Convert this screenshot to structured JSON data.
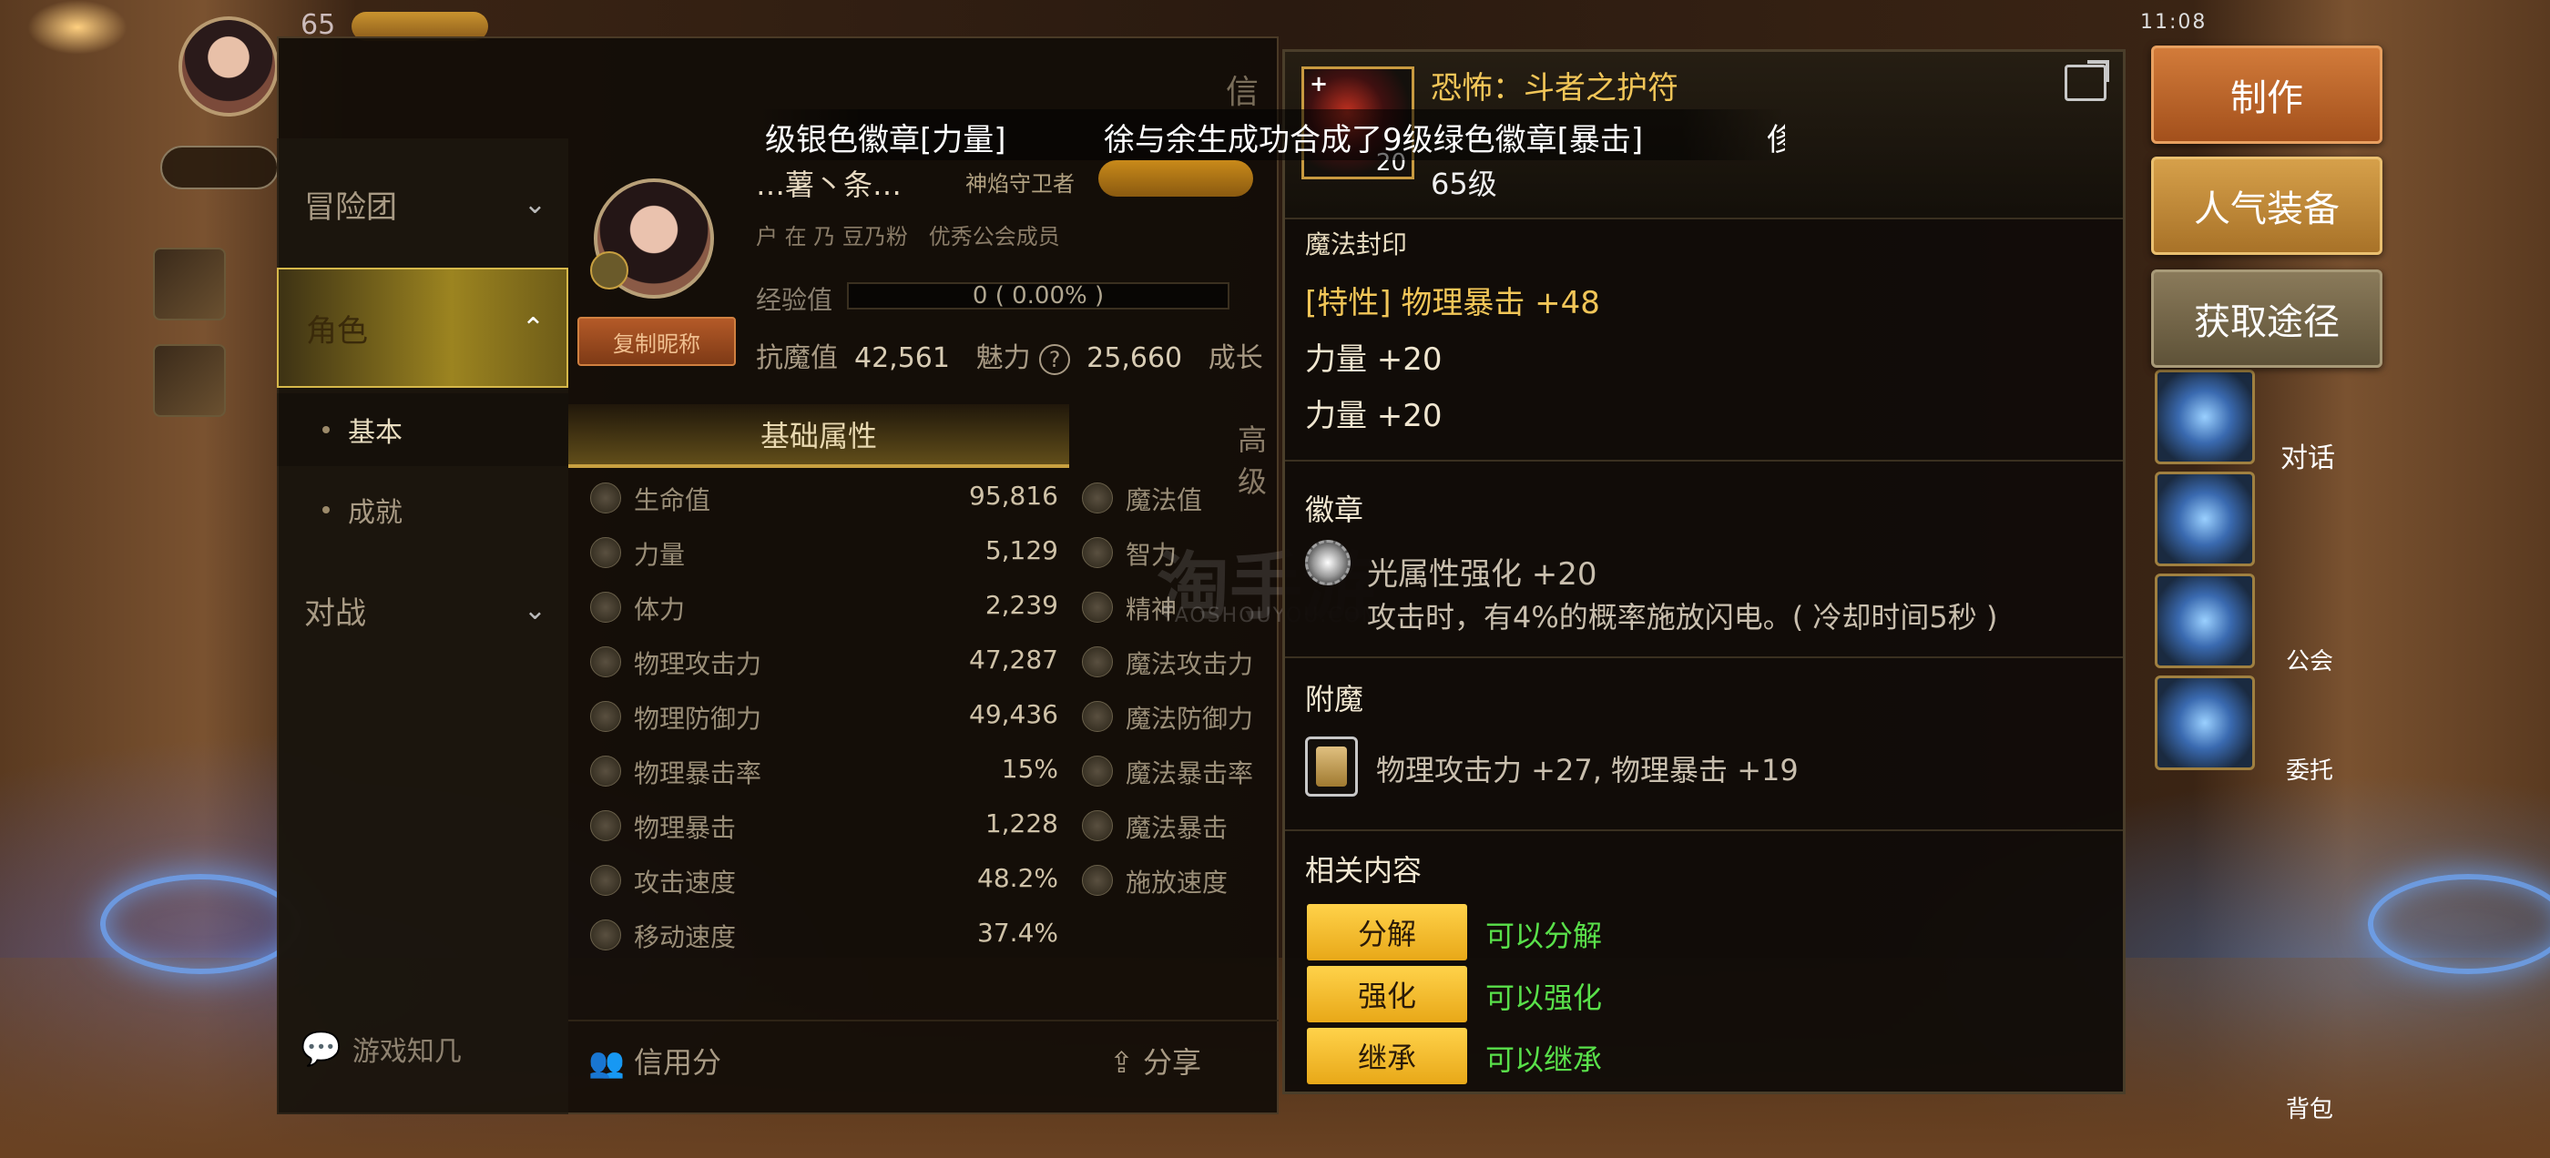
{
  "status_bar": {
    "level": "65",
    "clock": "11:08"
  },
  "marquee": {
    "segments": [
      "级银色徽章[力量]",
      "徐与余生成功合成了9级绿色徽章[暴击]",
      "侈"
    ]
  },
  "dialog": {
    "title_partial": "信",
    "nav": {
      "items": [
        {
          "label": "冒险团"
        },
        {
          "label": "角色"
        },
        {
          "label": "对战"
        }
      ],
      "subitems": [
        {
          "label": "基本"
        },
        {
          "label": "成就"
        }
      ],
      "footer": "游戏知几"
    },
    "character": {
      "name": "…薯丶条…",
      "title": "神焰守卫者",
      "guild_server": "豆乃粉",
      "guild_name": "优秀公会成员",
      "copy_button": "复制昵称",
      "exp_label": "经验值",
      "exp_value": "0 ( 0.00% )",
      "power_label": "抗魔值",
      "power_value": "42,561",
      "charm_label": "魅力",
      "charm_value": "25,660",
      "growth_label": "成长"
    },
    "tabs": {
      "basic": "基础属性",
      "advanced": "高级"
    },
    "attributes": [
      {
        "label": "生命值",
        "value": "95,816",
        "label2": "魔法值"
      },
      {
        "label": "力量",
        "value": "5,129",
        "label2": "智力"
      },
      {
        "label": "体力",
        "value": "2,239",
        "label2": "精神"
      },
      {
        "label": "物理攻击力",
        "value": "47,287",
        "label2": "魔法攻击力"
      },
      {
        "label": "物理防御力",
        "value": "49,436",
        "label2": "魔法防御力"
      },
      {
        "label": "物理暴击率",
        "value": "15%",
        "label2": "魔法暴击率"
      },
      {
        "label": "物理暴击",
        "value": "1,228",
        "label2": "魔法暴击"
      },
      {
        "label": "攻击速度",
        "value": "48.2%",
        "label2": "施放速度"
      },
      {
        "label": "移动速度",
        "value": "37.4%",
        "label2": ""
      }
    ],
    "footer": {
      "credit": "信用分",
      "share": "分享"
    }
  },
  "item": {
    "name": "恐怖：斗者之护符",
    "icon_enhance": "+",
    "icon_level": "20",
    "level": "65级",
    "seal": {
      "title": "魔法封印",
      "lines": [
        "[特性] 物理暴击 +48",
        "力量 +20",
        "力量 +20"
      ]
    },
    "emblem": {
      "title": "徽章",
      "name": "光属性强化 +20",
      "desc": "攻击时，有4%的概率施放闪电。( 冷却时间5秒 )"
    },
    "enchant": {
      "title": "附魔",
      "text": "物理攻击力 +27, 物理暴击 +19"
    },
    "related": {
      "title": "相关内容",
      "rows": [
        {
          "button": "分解",
          "text": "可以分解"
        },
        {
          "button": "强化",
          "text": "可以强化"
        },
        {
          "button": "继承",
          "text": "可以继承"
        }
      ]
    }
  },
  "actions": {
    "make": "制作",
    "popular": "人气装备",
    "source": "获取途径"
  },
  "right_side": {
    "chat": "对话",
    "guild": "公会",
    "mail": "委托",
    "bag": "背包"
  },
  "watermark": {
    "main": "淘手游",
    "sub": "TAOSHOUYOU.COM"
  }
}
